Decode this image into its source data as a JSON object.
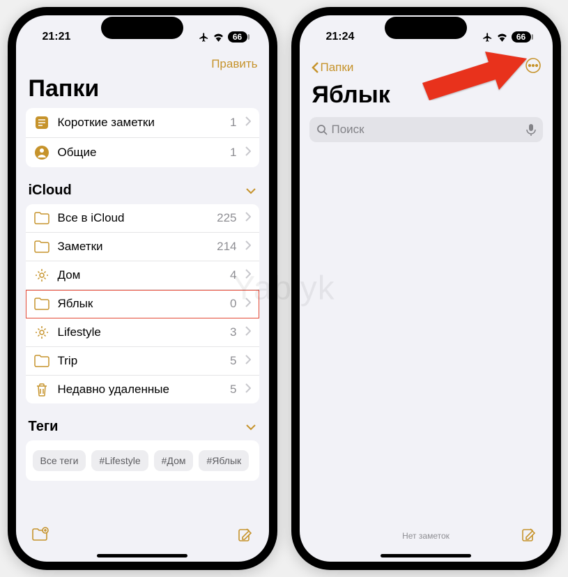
{
  "watermark": "Yablyk",
  "left_phone": {
    "status": {
      "time": "21:21",
      "battery": "66"
    },
    "nav": {
      "edit": "Править"
    },
    "title": "Папки",
    "top_group": [
      {
        "icon": "quicknote",
        "label": "Короткие заметки",
        "count": "1"
      },
      {
        "icon": "shared",
        "label": "Общие",
        "count": "1"
      }
    ],
    "section_icloud": "iCloud",
    "icloud_group": [
      {
        "icon": "folder",
        "label": "Все в iCloud",
        "count": "225",
        "highlight": false
      },
      {
        "icon": "folder",
        "label": "Заметки",
        "count": "214",
        "highlight": false
      },
      {
        "icon": "gear",
        "label": "Дом",
        "count": "4",
        "highlight": false
      },
      {
        "icon": "folder",
        "label": "Яблык",
        "count": "0",
        "highlight": true
      },
      {
        "icon": "gear",
        "label": "Lifestyle",
        "count": "3",
        "highlight": false
      },
      {
        "icon": "folder",
        "label": "Trip",
        "count": "5",
        "highlight": false
      },
      {
        "icon": "trash",
        "label": "Недавно удаленные",
        "count": "5",
        "highlight": false
      }
    ],
    "section_tags": "Теги",
    "tags": [
      "Все теги",
      "#Lifestyle",
      "#Дом",
      "#Яблык"
    ]
  },
  "right_phone": {
    "status": {
      "time": "21:24",
      "battery": "66"
    },
    "nav": {
      "back": "Папки"
    },
    "title": "Яблык",
    "search_placeholder": "Поиск",
    "empty_text": "Нет заметок"
  }
}
